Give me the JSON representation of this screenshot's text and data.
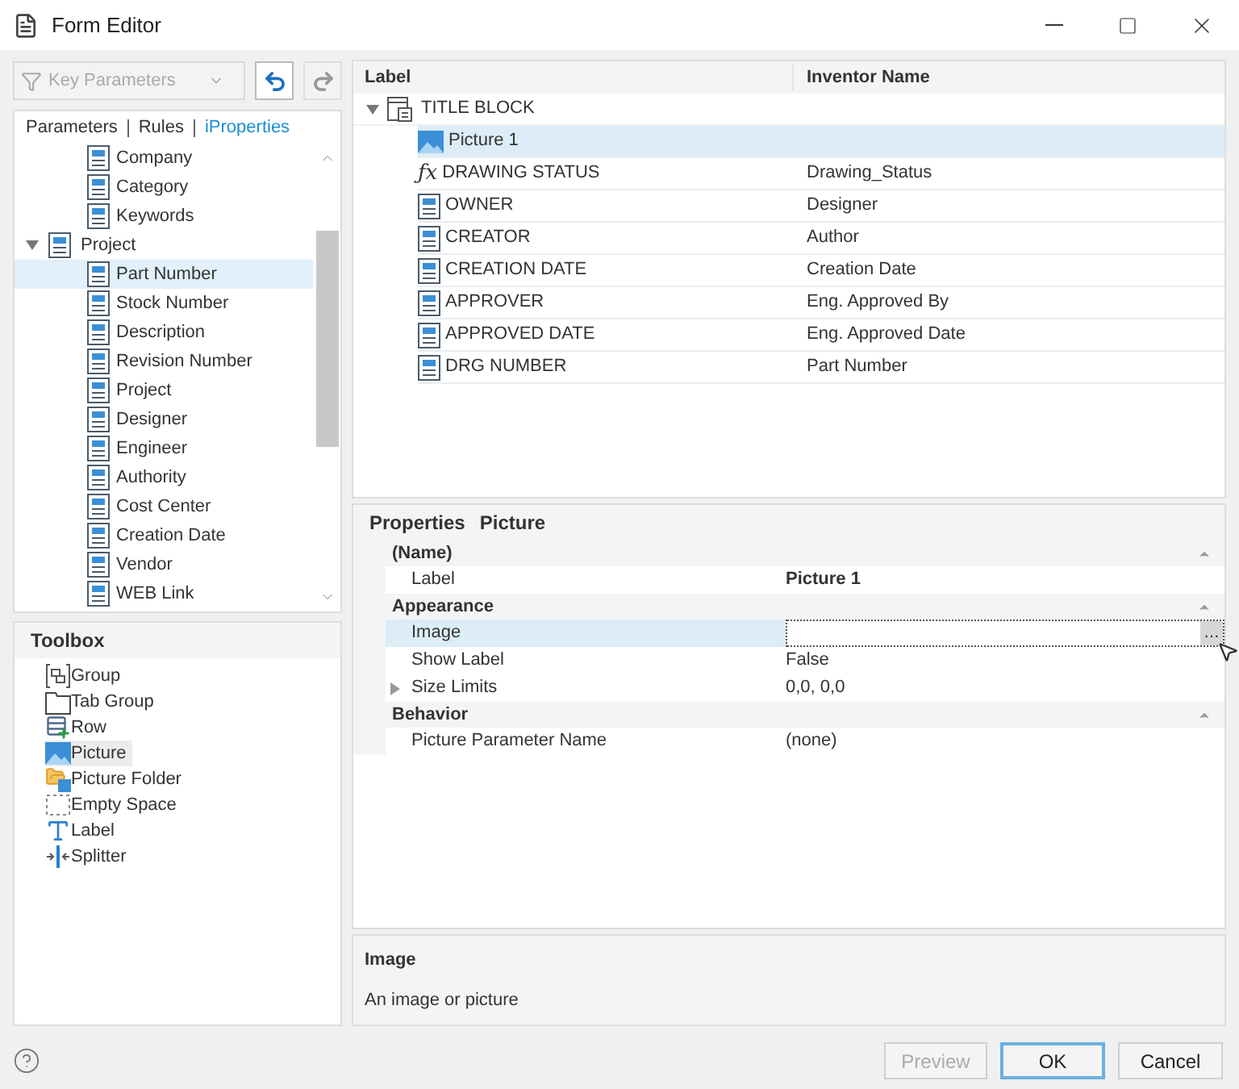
{
  "window": {
    "title": "Form Editor"
  },
  "filter": {
    "placeholder": "Key Parameters",
    "disabled": true
  },
  "nav_buttons": [
    {
      "kind": "undo",
      "disabled": false
    },
    {
      "kind": "redo",
      "disabled": true
    }
  ],
  "tabs": [
    {
      "label": "Parameters",
      "selected": false
    },
    {
      "label": "Rules",
      "selected": false
    },
    {
      "label": "iProperties",
      "selected": true
    }
  ],
  "param_tree": [
    {
      "kind": "property",
      "label": "Company",
      "selected": false
    },
    {
      "kind": "property",
      "label": "Category",
      "selected": false
    },
    {
      "kind": "property",
      "label": "Keywords",
      "selected": false
    },
    {
      "kind": "category",
      "label": "Project",
      "expanded": true,
      "selected": false,
      "children": [
        {
          "label": "Part Number",
          "selected": true
        },
        {
          "label": "Stock Number",
          "selected": false
        },
        {
          "label": "Description",
          "selected": false
        },
        {
          "label": "Revision Number",
          "selected": false
        },
        {
          "label": "Project",
          "selected": false
        },
        {
          "label": "Designer",
          "selected": false
        },
        {
          "label": "Engineer",
          "selected": false
        },
        {
          "label": "Authority",
          "selected": false
        },
        {
          "label": "Cost Center",
          "selected": false
        },
        {
          "label": "Creation Date",
          "selected": false
        },
        {
          "label": "Vendor",
          "selected": false
        },
        {
          "label": "WEB Link",
          "selected": false
        }
      ]
    }
  ],
  "toolbox": {
    "title": "Toolbox",
    "items": [
      {
        "kind": "group",
        "label": "Group",
        "selected": false
      },
      {
        "kind": "tabgroup",
        "label": "Tab Group",
        "selected": false
      },
      {
        "kind": "row",
        "label": "Row",
        "selected": false
      },
      {
        "kind": "picture",
        "label": "Picture",
        "selected": true
      },
      {
        "kind": "picturefolder",
        "label": "Picture Folder",
        "selected": false
      },
      {
        "kind": "emptyspace",
        "label": "Empty Space",
        "selected": false
      },
      {
        "kind": "label",
        "label": "Label",
        "selected": false
      },
      {
        "kind": "splitter",
        "label": "Splitter",
        "selected": false
      }
    ]
  },
  "form_tree": {
    "columns": [
      "Label",
      "Inventor Name"
    ],
    "rows": [
      {
        "kind": "group",
        "label": "TITLE BLOCK",
        "expanded": true,
        "children": [
          {
            "kind": "picture",
            "label": "Picture 1",
            "selected": true
          },
          {
            "kind": "formula",
            "formula_symbol": "ƒx",
            "label": "DRAWING STATUS",
            "inventor_name": "Drawing_Status",
            "selected": false
          },
          {
            "kind": "property",
            "label": "OWNER",
            "inventor_name": "Designer",
            "selected": false
          },
          {
            "kind": "property",
            "label": "CREATOR",
            "inventor_name": "Author",
            "selected": false
          },
          {
            "kind": "property",
            "label": "CREATION DATE",
            "inventor_name": "Creation Date",
            "selected": false
          },
          {
            "kind": "property",
            "label": "APPROVER",
            "inventor_name": "Eng. Approved By",
            "selected": false
          },
          {
            "kind": "property",
            "label": "APPROVED DATE",
            "inventor_name": "Eng. Approved Date",
            "selected": false
          },
          {
            "kind": "property",
            "label": "DRG NUMBER",
            "inventor_name": "Part Number",
            "selected": false
          }
        ]
      }
    ]
  },
  "properties": {
    "title": "Properties",
    "object": "Picture",
    "categories": [
      {
        "name": "(Name)",
        "expanded": true,
        "rows": [
          {
            "name": "Label",
            "value": "Picture 1",
            "modified": true,
            "selected": false
          }
        ]
      },
      {
        "name": "Appearance",
        "expanded": true,
        "rows": [
          {
            "name": "Image",
            "value": "",
            "modified": false,
            "selected": true,
            "editor_button": "…"
          },
          {
            "name": "Show Label",
            "value": "False",
            "modified": false,
            "selected": false
          },
          {
            "name": "Size Limits",
            "value": "0,0, 0,0",
            "modified": false,
            "selected": false,
            "expanded": false
          }
        ]
      },
      {
        "name": "Behavior",
        "expanded": true,
        "rows": [
          {
            "name": "Picture Parameter Name",
            "value": "(none)",
            "modified": false,
            "selected": false
          }
        ]
      }
    ]
  },
  "description": {
    "title": "Image",
    "text": "An image or picture"
  },
  "buttons": [
    {
      "label": "Preview",
      "disabled": true,
      "default": false
    },
    {
      "label": "OK",
      "disabled": false,
      "default": true
    },
    {
      "label": "Cancel",
      "disabled": false,
      "default": false
    }
  ]
}
